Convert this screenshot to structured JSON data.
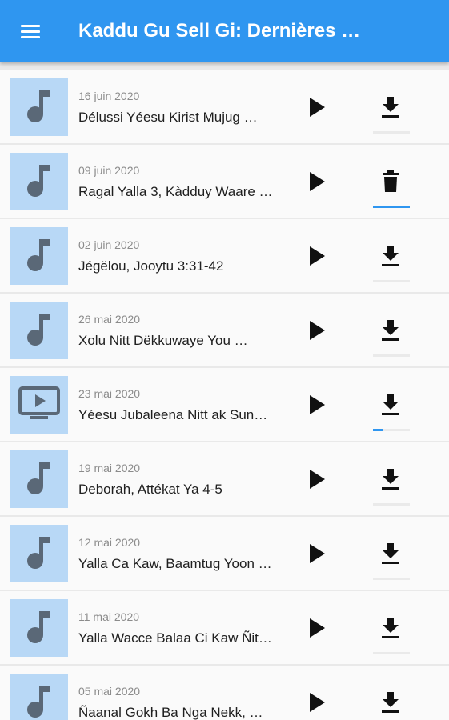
{
  "appbar": {
    "title": "Kaddu Gu Sell Gi: Dernières …",
    "menu_icon": "hamburger-menu-icon",
    "color": "#2f96f0"
  },
  "list": {
    "items": [
      {
        "date": "16 juin 2020",
        "title": "Délussi Yéesu Kirist Mujug …",
        "media": "music",
        "action": "download",
        "progress": 0
      },
      {
        "date": "09 juin 2020",
        "title": "Ragal Yalla 3, Kàdduy Waare …",
        "media": "music",
        "action": "delete",
        "progress": 1
      },
      {
        "date": "02 juin 2020",
        "title": "Jégëlou, Jooytu 3:31-42",
        "media": "music",
        "action": "download",
        "progress": 0
      },
      {
        "date": "26 mai 2020",
        "title": "Xolu Nitt Dëkkuwaye You …",
        "media": "music",
        "action": "download",
        "progress": 0
      },
      {
        "date": "23 mai 2020",
        "title": "Yéesu Jubaleena Nitt ak Sun…",
        "media": "video",
        "action": "download",
        "progress": 0.25
      },
      {
        "date": "19 mai 2020",
        "title": "Deborah, Attékat Ya 4-5",
        "media": "music",
        "action": "download",
        "progress": 0
      },
      {
        "date": "12 mai 2020",
        "title": "Yalla Ca Kaw, Baamtug Yoon …",
        "media": "music",
        "action": "download",
        "progress": 0
      },
      {
        "date": "11 mai 2020",
        "title": "Yalla Wacce Balaa Ci Kaw Ñit…",
        "media": "music",
        "action": "download",
        "progress": 0
      },
      {
        "date": "05 mai 2020",
        "title": "Ñaanal Gokh Ba Nga Nekk, …",
        "media": "music",
        "action": "download",
        "progress": 0
      }
    ]
  },
  "colors": {
    "thumb_bg": "#b8d8f6",
    "thumb_icon": "#5a6877",
    "progress_fill": "#2f96f0"
  }
}
